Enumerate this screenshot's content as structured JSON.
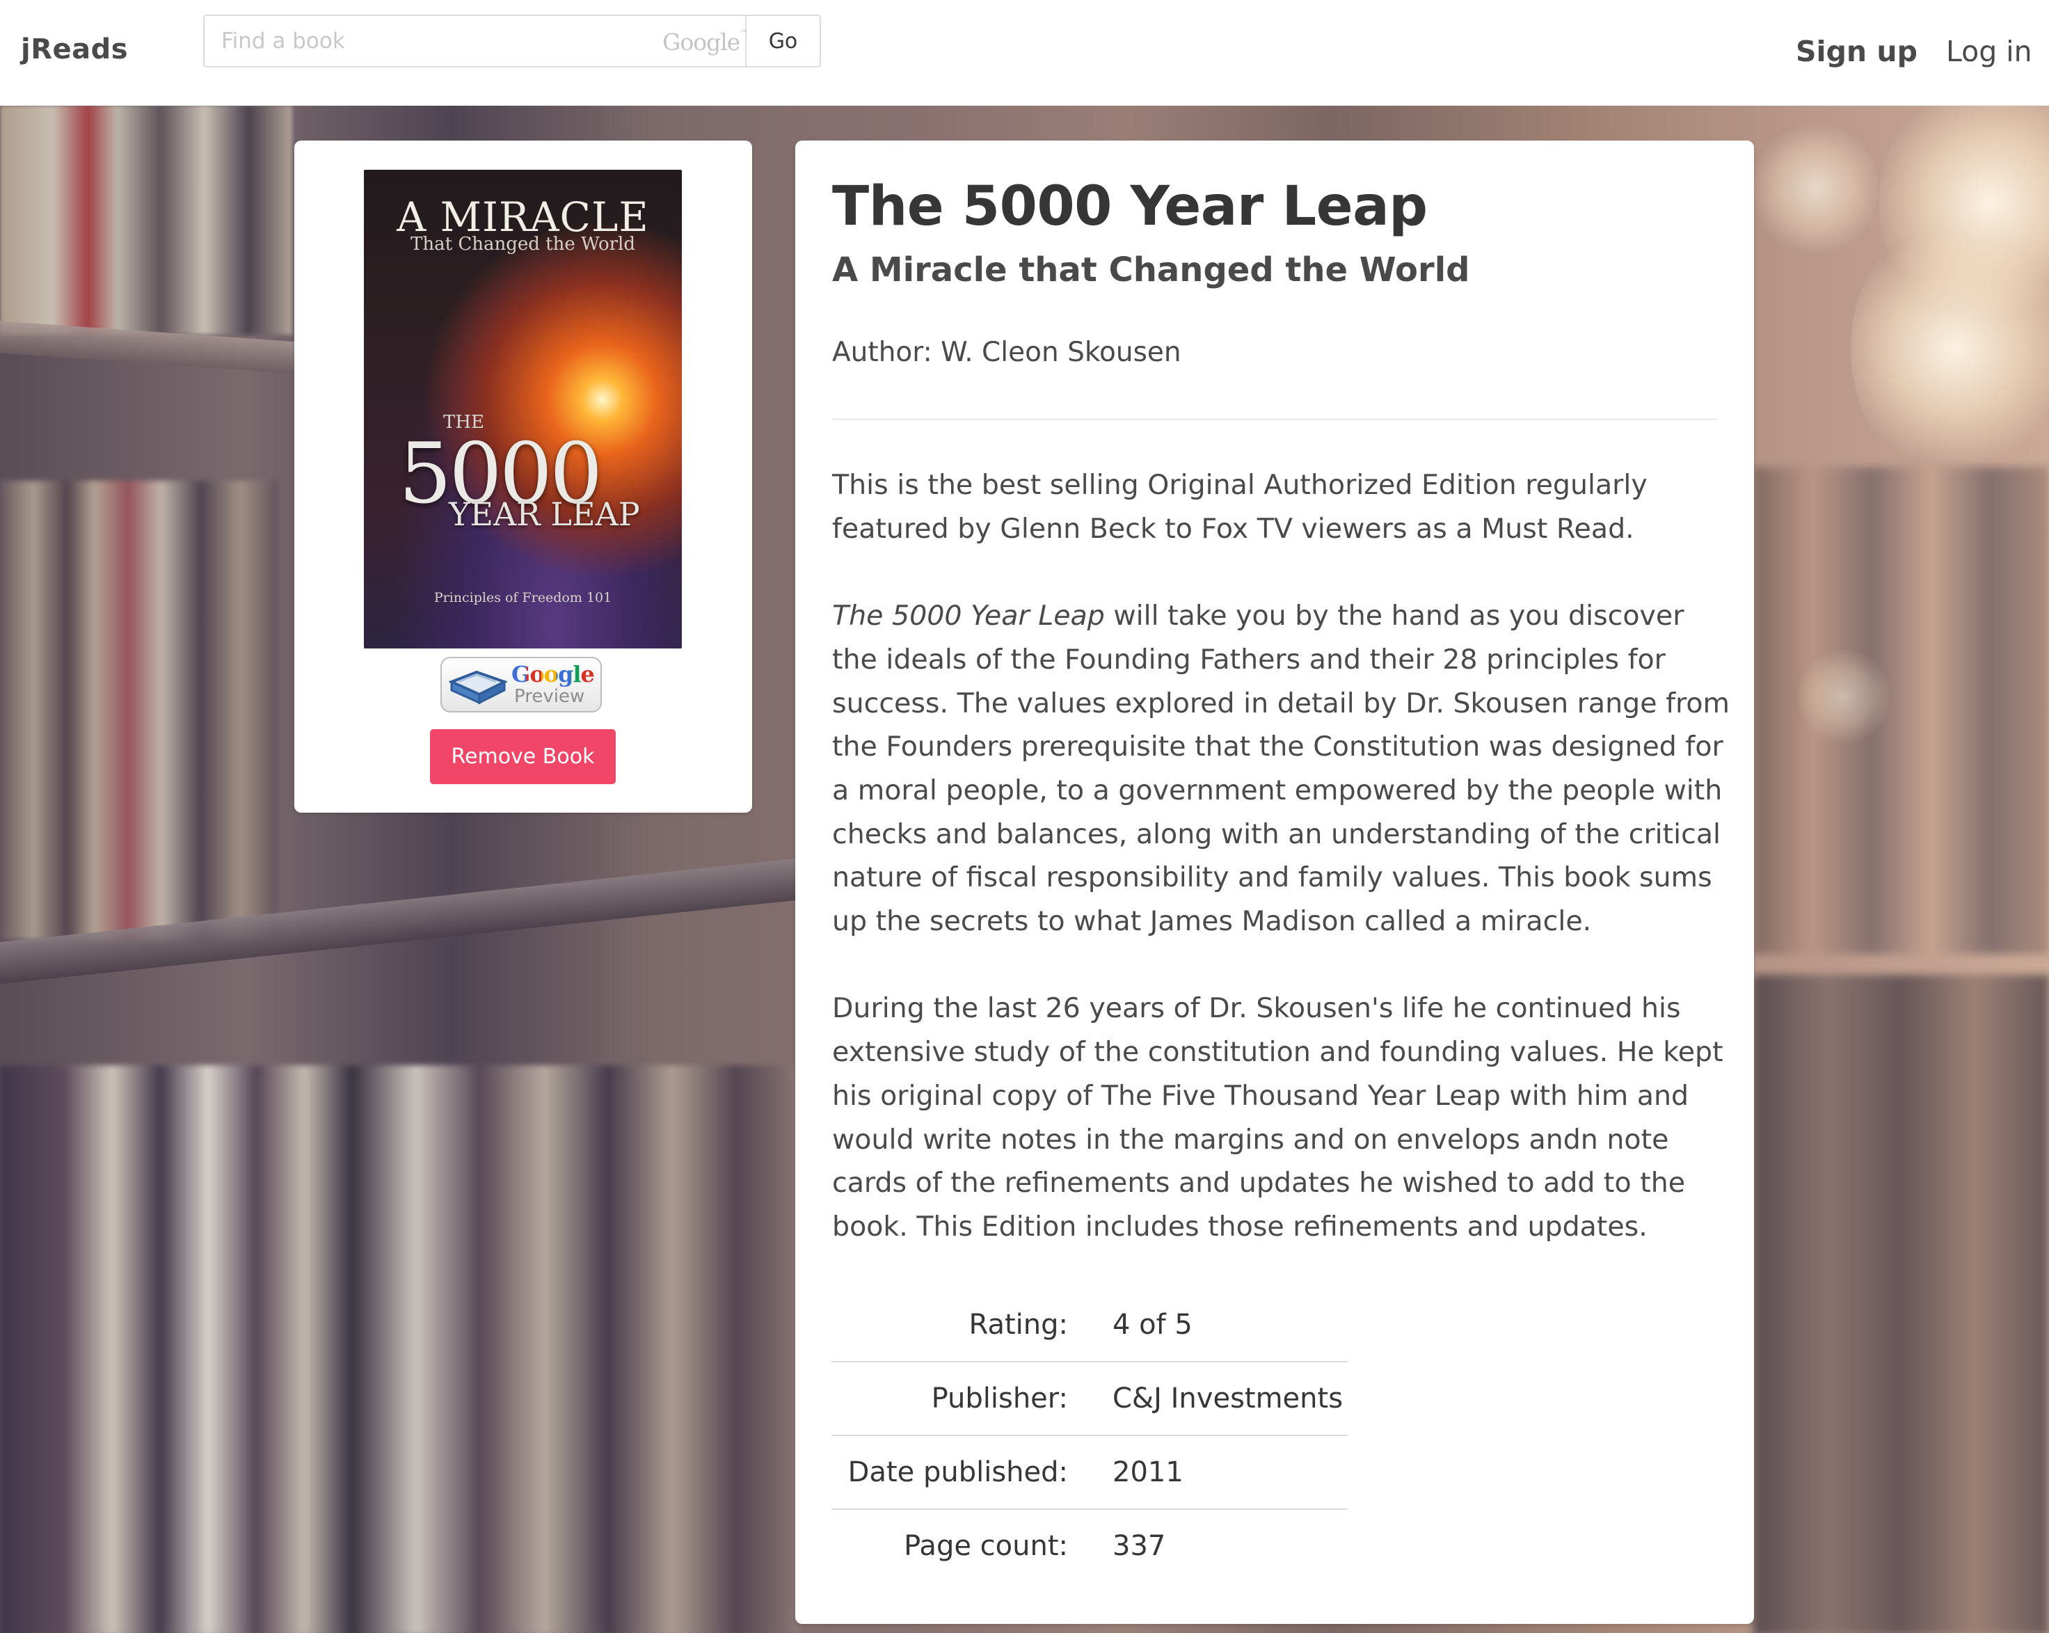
{
  "navbar": {
    "brand": "jReads",
    "search": {
      "placeholder": "Find a book",
      "value": "",
      "provider_mark": "Google",
      "button_label": "Go"
    },
    "signup_label": "Sign up",
    "login_label": "Log in"
  },
  "book": {
    "cover": {
      "line1": "A MIRACLE",
      "line2": "That Changed the World",
      "the": "THE",
      "number": "5000",
      "leap": "YEAR LEAP",
      "footer": "Principles of Freedom 101"
    },
    "preview_badge": {
      "brand": "Google",
      "label": "Preview"
    },
    "remove_label": "Remove Book",
    "title": "The 5000 Year Leap",
    "subtitle": "A Miracle that Changed the World",
    "author": "Author: W. Cleon Skousen",
    "description": {
      "p1": "This is the best selling Original Authorized Edition regularly featured by Glenn Beck to Fox TV viewers as a Must Read.",
      "p2_italic": "The 5000 Year Leap",
      "p2_rest": " will take you by the hand as you discover the ideals of the Founding Fathers and their 28 principles for success. The values explored in detail by Dr. Skousen range from the Founders prerequisite that the Constitution was designed for a moral people, to a government empowered by the people with checks and balances, along with an understanding of the critical nature of fiscal responsibility and family values. This book sums up the secrets to what James Madison called a miracle.",
      "p3": "During the last 26 years of Dr. Skousen's life he continued his extensive study of the constitution and founding values. He kept his original copy of The Five Thousand Year Leap with him and would write notes in the margins and on envelops andn note cards of the refinements and updates he wished to add to the book. This Edition includes those refinements and updates."
    },
    "meta": [
      {
        "label": "Rating:",
        "value": "4 of 5"
      },
      {
        "label": "Publisher:",
        "value": "C&J Investments"
      },
      {
        "label": "Date published:",
        "value": "2011"
      },
      {
        "label": "Page count:",
        "value": "337"
      }
    ]
  },
  "colors": {
    "danger": "#f14668",
    "text": "#4a4a4a",
    "heading": "#363636"
  }
}
